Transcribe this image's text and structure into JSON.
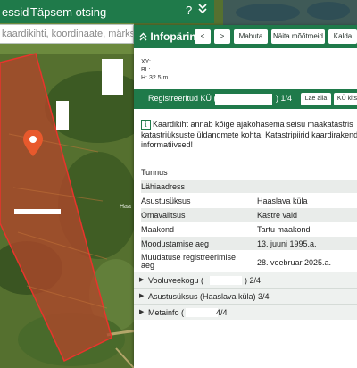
{
  "topbar": {
    "item1": "essid",
    "item2": "Täpsem otsing",
    "help": "?",
    "collapse": "⌄"
  },
  "search": {
    "placeholder": "kaardikihti, koordinaate, märksõna, tunnus"
  },
  "panel": {
    "title": "Infopäring",
    "prev": "<",
    "next": ">",
    "mahuta": "Mahuta",
    "naita": "Näita mõõtmeid",
    "kalda": "Kalda",
    "coords": {
      "xy": "XY:",
      "bl": "BL:",
      "h": "H: 32.5 m"
    },
    "header": {
      "label": "Registreeritud KÜ (",
      "count": ") 1/4",
      "btn_down": "Lae alla",
      "btn_ku": "KÜ kits"
    },
    "info_lines": [
      "Kaardikiht annab kõige ajakohasema seisu maakatastris",
      "katastriüksuste üldandmete kohta. Katastripiirid kaardirakend",
      "informatiivsed!"
    ],
    "rows": [
      {
        "k": "Tunnus",
        "v": ""
      },
      {
        "k": "Lähiaadress",
        "v": ""
      },
      {
        "k": "Asustusüksus",
        "v": "Haaslava küla"
      },
      {
        "k": "Omavalitsus",
        "v": "Kastre vald"
      },
      {
        "k": "Maakond",
        "v": "Tartu maakond"
      },
      {
        "k": "Moodustamise aeg",
        "v": "13. juuni 1995.a."
      },
      {
        "k": "Muudatuse registreerimise",
        "k2": "aeg",
        "v": "28. veebruar 2025.a."
      }
    ],
    "sections": [
      {
        "label": "Vooluveekogu (",
        "suffix": ") 2/4"
      },
      {
        "label": "Asustusüksus (Haaslava küla) 3/4",
        "suffix": ""
      },
      {
        "label": "Metainfo (",
        "suffix": "4/4"
      }
    ]
  },
  "map": {
    "side_label": "Haa"
  },
  "colors": {
    "brand": "#1f7a4a",
    "parcel_fill": "#b0472a",
    "parcel_stroke": "#e8342c",
    "pin": "#e8592c"
  }
}
